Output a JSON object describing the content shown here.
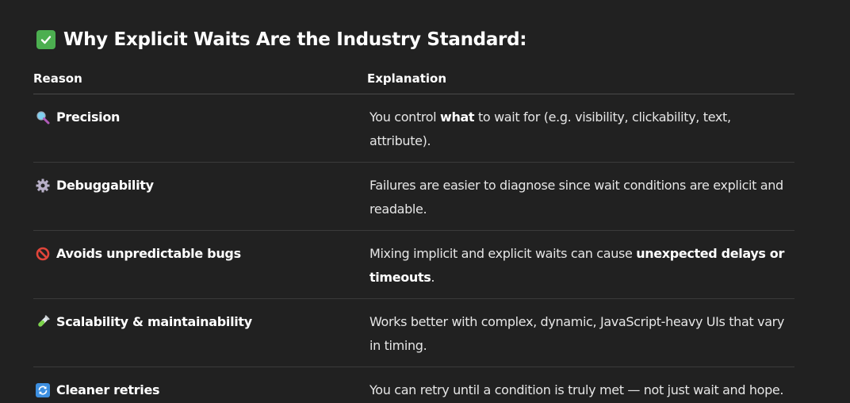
{
  "heading": {
    "icon": "check-mark-button-icon",
    "text": "Why Explicit Waits Are the Industry Standard:"
  },
  "table": {
    "headers": {
      "reason": "Reason",
      "explanation": "Explanation"
    },
    "rows": [
      {
        "icon": "magnifying-glass-icon",
        "reason": "Precision",
        "explanation": [
          {
            "text": "You control ",
            "bold": false
          },
          {
            "text": "what",
            "bold": true
          },
          {
            "text": " to wait for (e.g. visibility, clickability, text, attribute).",
            "bold": false
          }
        ]
      },
      {
        "icon": "gear-icon",
        "reason": "Debuggability",
        "explanation": [
          {
            "text": "Failures are easier to diagnose since wait conditions are explicit and readable.",
            "bold": false
          }
        ]
      },
      {
        "icon": "prohibited-icon",
        "reason": "Avoids unpredictable bugs",
        "explanation": [
          {
            "text": "Mixing implicit and explicit waits can cause ",
            "bold": false
          },
          {
            "text": "unexpected delays or timeouts",
            "bold": true
          },
          {
            "text": ".",
            "bold": false
          }
        ]
      },
      {
        "icon": "test-tube-icon",
        "reason": "Scalability & maintainability",
        "explanation": [
          {
            "text": "Works better with complex, dynamic, JavaScript-heavy UIs that vary in timing.",
            "bold": false
          }
        ]
      },
      {
        "icon": "repeat-arrows-icon",
        "reason": "Cleaner retries",
        "explanation": [
          {
            "text": "You can retry until a condition is truly met — not just wait and hope.",
            "bold": false
          }
        ]
      }
    ]
  }
}
